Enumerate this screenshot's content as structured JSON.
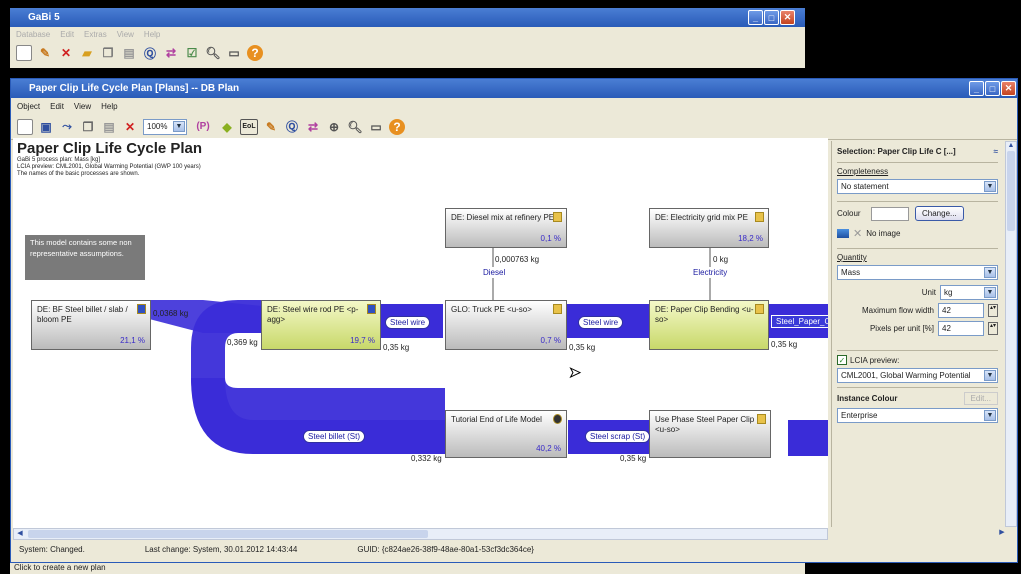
{
  "main_window": {
    "title": "GaBi 5",
    "menu": [
      "Database",
      "Edit",
      "Extras",
      "View",
      "Help"
    ]
  },
  "plan_window": {
    "title": "Paper Clip Life Cycle Plan [Plans] -- DB Plan",
    "menu": [
      "Object",
      "Edit",
      "View",
      "Help"
    ],
    "zoom": "100%",
    "status": {
      "system": "System: Changed.",
      "last_change": "Last change: System, 30.01.2012 14:43:44",
      "guid": "GUID: {c824ae26-38f9-48ae-80a1-53cf3dc364ce}"
    }
  },
  "plan": {
    "title": "Paper Clip Life Cycle Plan",
    "subtitle1": "GaBi 5 process plan: Mass [kg]",
    "subtitle2": "LCIA preview: CML2001, Global Warming Potential (GWP 100 years)",
    "subtitle3": "The names of the basic processes are shown.",
    "note": "This model contains some non representative assumptions."
  },
  "processes": {
    "bf_steel": {
      "name": "DE: BF Steel billet / slab / bloom PE",
      "pct": "21,1 %"
    },
    "wire_rod": {
      "name": "DE: Steel wire rod PE <p-agg>",
      "pct": "19,7 %"
    },
    "truck": {
      "name": "GLO: Truck PE <u-so>",
      "pct": "0,7 %"
    },
    "bending": {
      "name": "DE: Paper Clip Bending <u-so>"
    },
    "diesel": {
      "name": "DE: Diesel mix at refinery PE",
      "pct": "0,1 %"
    },
    "electricity": {
      "name": "DE: Electricity grid mix PE",
      "pct": "18,2 %"
    },
    "eol": {
      "name": "Tutorial End of Life Model",
      "pct": "40,2 %"
    },
    "use_phase": {
      "name": "Use Phase Steel Paper Clip <u-so>"
    }
  },
  "flows": {
    "steel_wire_1": "Steel wire",
    "steel_wire_2": "Steel wire",
    "steel_paper": "Steel_Paper_C",
    "diesel": "Diesel",
    "electricity": "Electricity",
    "steel_billet": "Steel billet (St)",
    "steel_scrap": "Steel scrap (St)"
  },
  "amounts": {
    "a1": "0,0368 kg",
    "a2": "0,369 kg",
    "a3": "0,35 kg",
    "a4": "0,35 kg",
    "a5": "0,35 kg",
    "a6": "0,000763 kg",
    "a7": "0 kg",
    "a8": "0,332 kg",
    "a9": "0,35 kg"
  },
  "panel": {
    "header": "Selection: Paper Clip Life C [...]",
    "completeness_label": "Completeness",
    "completeness_value": "No statement",
    "colour_label": "Colour",
    "change_button": "Change...",
    "no_image": "No image",
    "quantity_label": "Quantity",
    "quantity_value": "Mass",
    "unit_label": "Unit",
    "unit_value": "kg",
    "max_flow_label": "Maximum flow width",
    "max_flow_value": "42",
    "pixels_label": "Pixels per unit [%]",
    "pixels_value": "42",
    "lcia_label": "LCIA preview:",
    "lcia_value": "CML2001, Global Warming Potential",
    "instance_label": "Instance Colour",
    "edit_button": "Edit...",
    "instance_value": "Enterprise"
  },
  "bottom_status": "Click to create a new plan"
}
